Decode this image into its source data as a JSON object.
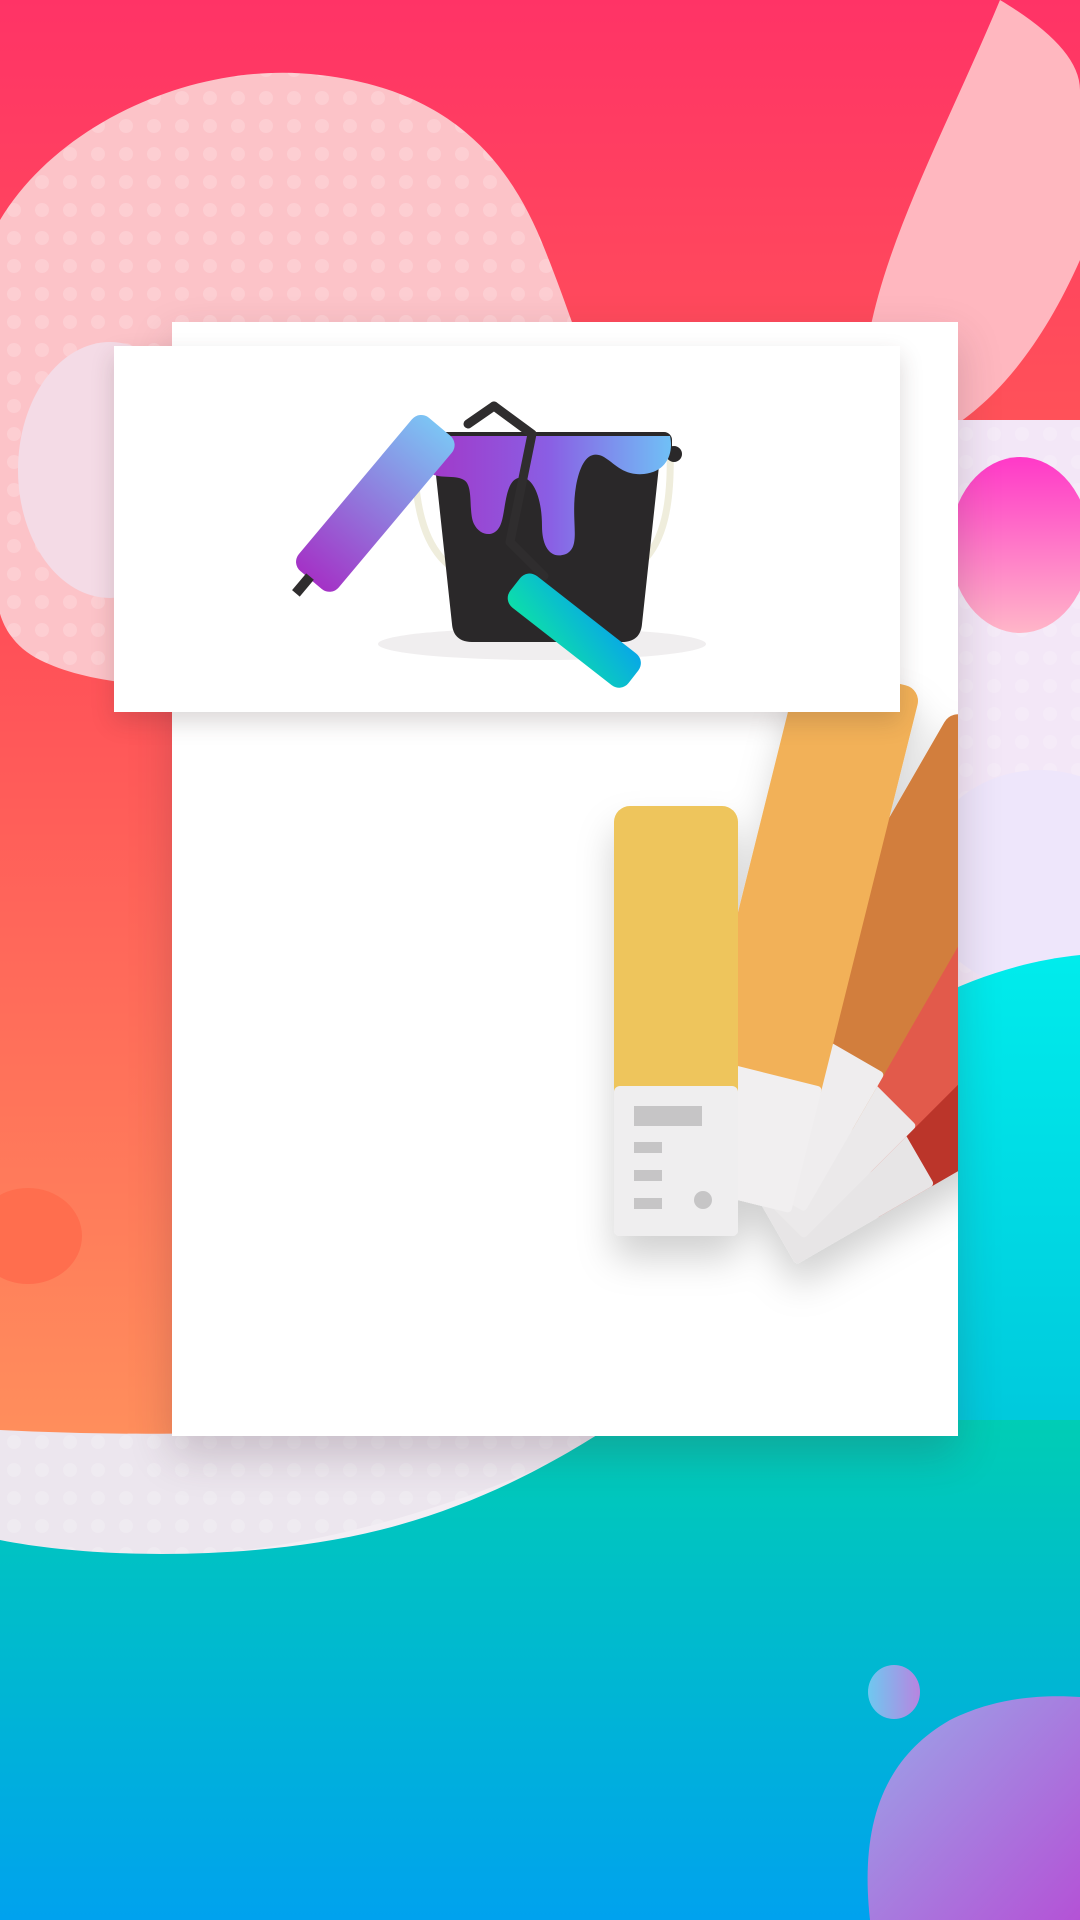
{
  "screen": {
    "title": ""
  },
  "illustrations": {
    "top": "paint-bucket-with-rollers",
    "bottom": "color-swatch-fan"
  },
  "colors": {
    "accent_pink": "#ff3366",
    "accent_teal": "#00c9b7",
    "accent_blue": "#00a6ec",
    "bucket": "#2a2829",
    "paint_purple": "#8a56e0",
    "paint_blue": "#6fb8f5",
    "roller_green": "#10d9b0",
    "swatch_yellow": "#eec55c",
    "swatch_orange": "#f2b159",
    "swatch_amber": "#d27e3d",
    "swatch_coral": "#e25a4b",
    "swatch_red": "#bb352b"
  }
}
